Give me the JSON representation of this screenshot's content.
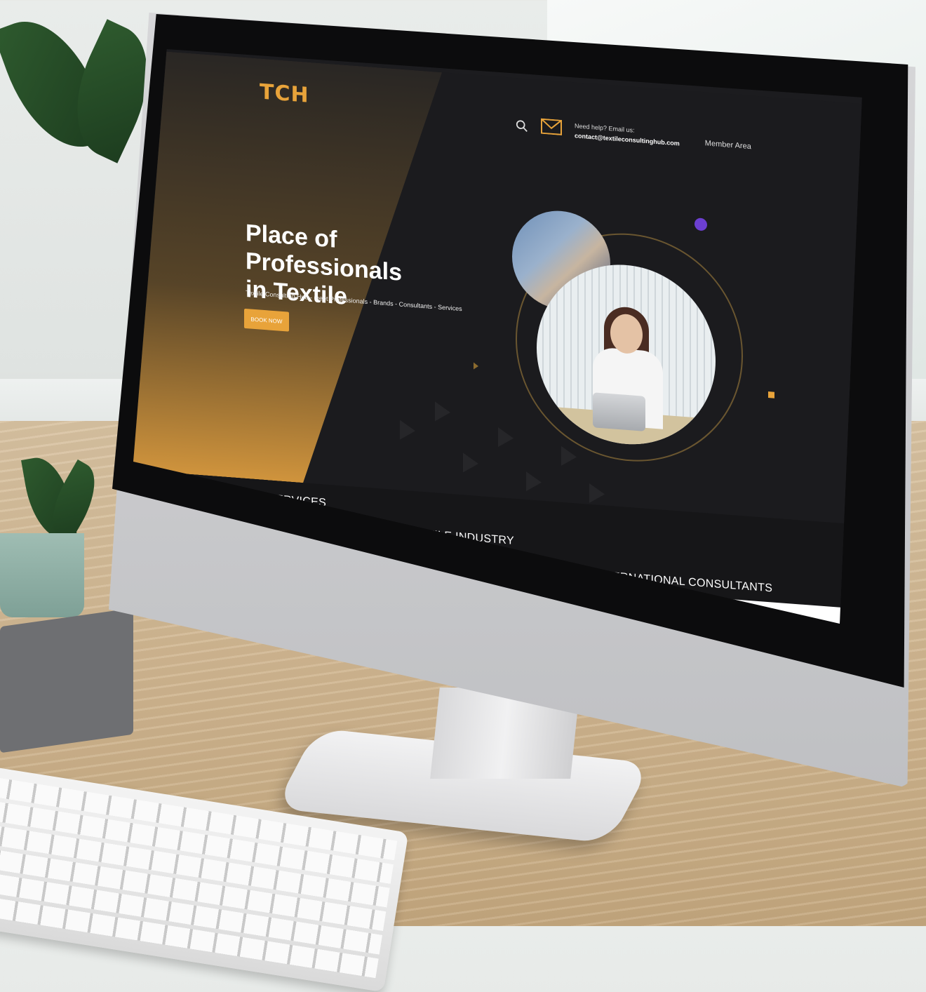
{
  "header": {
    "logo_text": "TCH",
    "help_label": "Need help? Email us:",
    "help_email": "contact@textileconsultinghub.com",
    "member_area": "Member Area"
  },
  "hero": {
    "title_line1": "Place of Professionals",
    "title_line2": "in Textile",
    "subtitle": "Textile Consulting Hub - meet Professionals - Brands - Consultants - Services",
    "cta_label": "BOOK NOW"
  },
  "ticker": {
    "items": [
      "MENTING CONSULTING SERVICES",
      "SOFTWARES FOR TEXTILE INDUSTRY",
      "HIGH PROFILE INTERNATIONAL CONSULTANTS"
    ]
  },
  "colors": {
    "accent": "#e8a33a",
    "background": "#1b1b1e",
    "text": "#ffffff"
  },
  "icons": {
    "search": "search-icon",
    "mail": "mail-icon"
  }
}
